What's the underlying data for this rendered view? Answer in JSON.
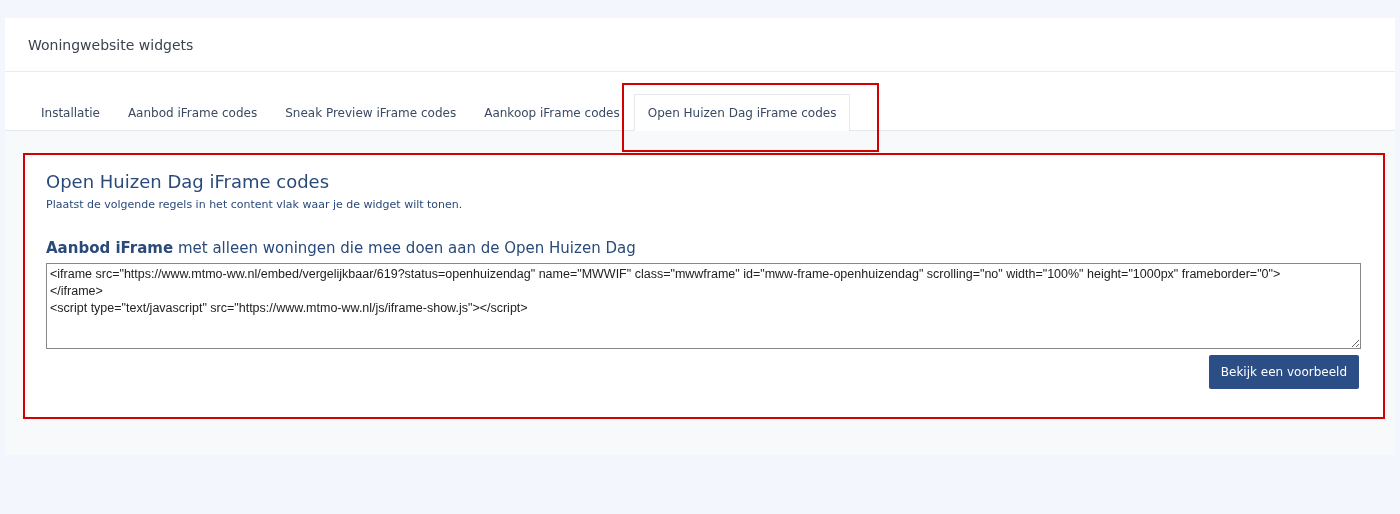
{
  "page": {
    "title": "Woningwebsite widgets"
  },
  "tabs": [
    {
      "label": "Installatie",
      "selected": false,
      "highlighted": false
    },
    {
      "label": "Aanbod iFrame codes",
      "selected": false,
      "highlighted": false
    },
    {
      "label": "Sneak Preview iFrame codes",
      "selected": false,
      "highlighted": false
    },
    {
      "label": "Aankoop iFrame codes",
      "selected": false,
      "highlighted": false
    },
    {
      "label": "Open Huizen Dag iFrame codes",
      "selected": true,
      "highlighted": true
    }
  ],
  "panel": {
    "highlighted": true,
    "heading": "Open Huizen Dag iFrame codes",
    "instruction": "Plaatst de volgende regels in het content vlak waar je de widget wilt tonen.",
    "code_label": "**Aanbod iFrame** met alleen woningen die mee doen aan de Open Huizen Dag",
    "code": "<iframe src=\"https://www.mtmo-ww.nl/embed/vergelijkbaar/619?status=openhuizendag\" name=\"MWWIF\" class=\"mwwframe\" id=\"mww-frame-openhuizendag\" scrolling=\"no\" width=\"100%\" height=\"1000px\" frameborder=\"0\">\n</iframe>\n<script type=\"text/javascript\" src=\"https://www.mtmo-ww.nl/js/iframe-show.js\"></script>",
    "button": "Bekijk een voorbeeld"
  }
}
